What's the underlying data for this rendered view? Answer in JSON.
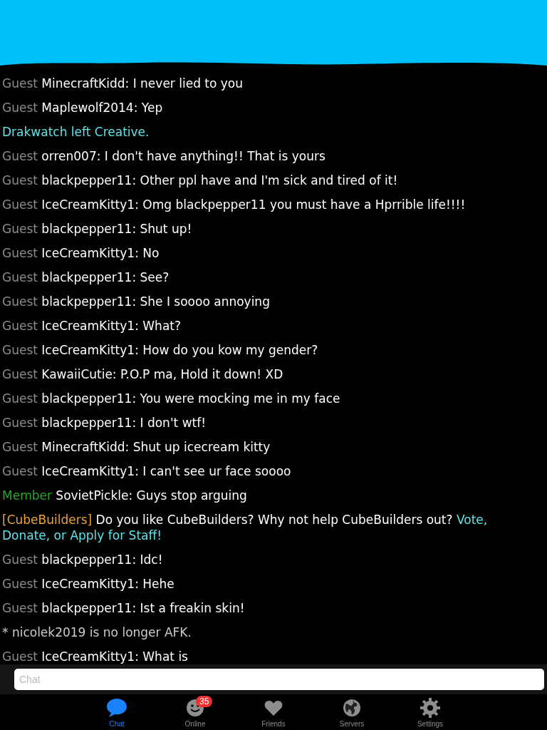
{
  "messages": [
    {
      "kind": "chat",
      "rank": "Guest",
      "name": "MinecraftKidd:",
      "text": "I never lied to you"
    },
    {
      "kind": "chat",
      "rank": "Guest",
      "name": "Maplewolf2014:",
      "text": "Yep"
    },
    {
      "kind": "system",
      "text": "Drakwatch left Creative.",
      "color": "#5ee3ea"
    },
    {
      "kind": "chat",
      "rank": "Guest",
      "name": "orren007:",
      "text": "I don't have anything!! That is yours"
    },
    {
      "kind": "chat",
      "rank": "Guest",
      "name": "blackpepper11:",
      "text": "Other ppl have and I'm sick and tired of it!"
    },
    {
      "kind": "chat",
      "rank": "Guest",
      "name": "IceCreamKitty1:",
      "text": "Omg blackpepper11 you must have a Hprrible life!!!!"
    },
    {
      "kind": "chat",
      "rank": "Guest",
      "name": "blackpepper11:",
      "text": "Shut up!"
    },
    {
      "kind": "chat",
      "rank": "Guest",
      "name": "IceCreamKitty1:",
      "text": "No"
    },
    {
      "kind": "chat",
      "rank": "Guest",
      "name": "blackpepper11:",
      "text": "See?"
    },
    {
      "kind": "chat",
      "rank": "Guest",
      "name": "blackpepper11:",
      "text": "She I soooo annoying"
    },
    {
      "kind": "chat",
      "rank": "Guest",
      "name": "IceCreamKitty1:",
      "text": "What?"
    },
    {
      "kind": "chat",
      "rank": "Guest",
      "name": "IceCreamKitty1:",
      "text": "How do you kow my gender?"
    },
    {
      "kind": "chat",
      "rank": "Guest",
      "name": "KawaiiCutie:",
      "text": "P.O.P ma, Hold it down! XD"
    },
    {
      "kind": "chat",
      "rank": "Guest",
      "name": "blackpepper11:",
      "text": "You were mocking me in my face"
    },
    {
      "kind": "chat",
      "rank": "Guest",
      "name": "blackpepper11:",
      "text": "I don't wtf!"
    },
    {
      "kind": "chat",
      "rank": "Guest",
      "name": "MinecraftKidd:",
      "text": "Shut up icecream kitty"
    },
    {
      "kind": "chat",
      "rank": "Guest",
      "name": "IceCreamKitty1:",
      "text": "I can't see ur face soooo"
    },
    {
      "kind": "chat",
      "rank": "Member",
      "name": "SovietPickle:",
      "text": "Guys stop arguing"
    },
    {
      "kind": "broadcast",
      "tag": "[CubeBuilders]",
      "text": "Do you like CubeBuilders? Why not help CubeBuilders out?",
      "link": "Vote, Donate, or Apply for Staff!"
    },
    {
      "kind": "chat",
      "rank": "Guest",
      "name": "blackpepper11:",
      "text": "Idc!"
    },
    {
      "kind": "chat",
      "rank": "Guest",
      "name": "IceCreamKitty1:",
      "text": "Hehe"
    },
    {
      "kind": "chat",
      "rank": "Guest",
      "name": "blackpepper11:",
      "text": "Ist a freakin skin!"
    },
    {
      "kind": "system",
      "text": "* nicolek2019 is no longer AFK.",
      "color": "#cccccc"
    },
    {
      "kind": "chat",
      "rank": "Guest",
      "name": "IceCreamKitty1:",
      "text": "What is"
    }
  ],
  "input": {
    "placeholder": "Chat"
  },
  "tabs": [
    {
      "label": "Chat",
      "selected": true
    },
    {
      "label": "Online",
      "selected": false,
      "badge": "35"
    },
    {
      "label": "Friends",
      "selected": false
    },
    {
      "label": "Servers",
      "selected": false
    },
    {
      "label": "Settings",
      "selected": false
    }
  ]
}
